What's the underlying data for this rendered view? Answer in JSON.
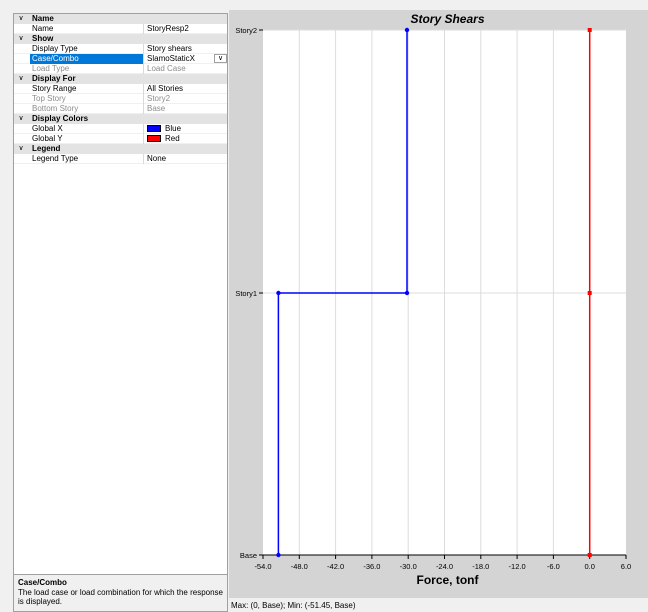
{
  "property_grid": {
    "sections": [
      {
        "title": "Name",
        "rows": [
          {
            "label": "Name",
            "value": "StoryResp2"
          }
        ]
      },
      {
        "title": "Show",
        "rows": [
          {
            "label": "Display Type",
            "value": "Story shears"
          },
          {
            "label": "Case/Combo",
            "value": "SlamoStaticX",
            "selected": true,
            "dropdown": true
          },
          {
            "label": "Load Type",
            "value": "Load Case",
            "disabled": true
          }
        ]
      },
      {
        "title": "Display For",
        "rows": [
          {
            "label": "Story Range",
            "value": "All Stories"
          },
          {
            "label": "Top Story",
            "value": "Story2",
            "disabled": true
          },
          {
            "label": "Bottom Story",
            "value": "Base",
            "disabled": true
          }
        ]
      },
      {
        "title": "Display Colors",
        "rows": [
          {
            "label": "Global X",
            "value": "Blue",
            "swatch": "#0000ff"
          },
          {
            "label": "Global Y",
            "value": "Red",
            "swatch": "#ff0000"
          }
        ]
      },
      {
        "title": "Legend",
        "rows": [
          {
            "label": "Legend Type",
            "value": "None"
          }
        ]
      }
    ]
  },
  "description": {
    "title": "Case/Combo",
    "text": "The load case or load combination for which the response is displayed."
  },
  "status_bar": {
    "text": "Max: (0, Base);  Min: (-51.45, Base)"
  },
  "chart_data": {
    "type": "line",
    "title": "Story Shears",
    "xlabel": "Force, tonf",
    "ylabel": "",
    "xlim": [
      -54,
      6
    ],
    "x_ticks": [
      "-54.0",
      "-48.0",
      "-42.0",
      "-36.0",
      "-30.0",
      "-24.0",
      "-18.0",
      "-12.0",
      "-6.0",
      "0.0",
      "6.0"
    ],
    "x_tick_values": [
      -54,
      -48,
      -42,
      -36,
      -30,
      -24,
      -18,
      -12,
      -6,
      0,
      6
    ],
    "y_categories": [
      "Base",
      "Story1",
      "Story2"
    ],
    "grid": true,
    "series": [
      {
        "name": "Global X",
        "color": "#0000ff",
        "points": [
          [
            -51.45,
            "Base"
          ],
          [
            -51.45,
            "Story1"
          ],
          [
            -30.2,
            "Story1"
          ],
          [
            -30.2,
            "Story2"
          ]
        ]
      },
      {
        "name": "Global Y",
        "color": "#ff0000",
        "points": [
          [
            0,
            "Base"
          ],
          [
            0,
            "Story1"
          ],
          [
            0,
            "Story2"
          ]
        ]
      }
    ]
  }
}
